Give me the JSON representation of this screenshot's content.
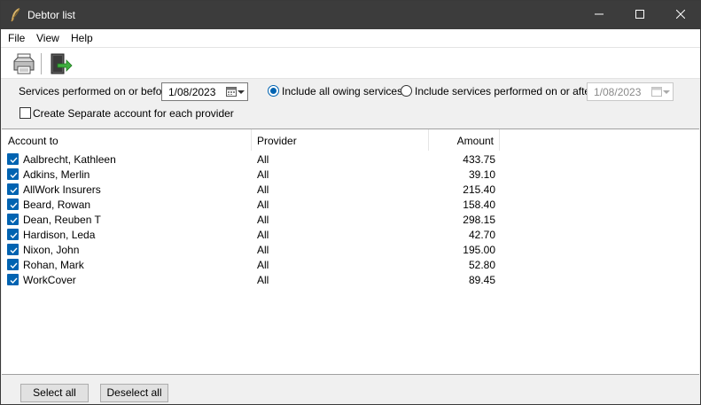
{
  "window": {
    "title": "Debtor list",
    "icons": {
      "app": "feather-quill-icon",
      "minimize": "minimize-icon",
      "maximize": "maximize-icon",
      "close": "close-icon"
    }
  },
  "menu": {
    "items": [
      {
        "label": "File"
      },
      {
        "label": "View"
      },
      {
        "label": "Help"
      }
    ]
  },
  "toolbar": {
    "print_icon": "printer-icon",
    "exit_icon": "exit-door-icon"
  },
  "options": {
    "services_before_label": "Services performed on or before:",
    "services_before_date": "1/08/2023",
    "include_all_label": "Include all owing services",
    "include_all_selected": true,
    "include_after_label": "Include services performed on or after",
    "include_after_selected": false,
    "services_after_date": "1/08/2023",
    "separate_account_label": "Create Separate account for each provider",
    "separate_account_checked": false
  },
  "list": {
    "columns": [
      "Account to",
      "Provider",
      "Amount"
    ],
    "rows": [
      {
        "account": "Aalbrecht, Kathleen",
        "provider": "All",
        "amount": "433.75",
        "checked": true
      },
      {
        "account": "Adkins, Merlin",
        "provider": "All",
        "amount": "39.10",
        "checked": true
      },
      {
        "account": "AllWork Insurers",
        "provider": "All",
        "amount": "215.40",
        "checked": true
      },
      {
        "account": "Beard, Rowan",
        "provider": "All",
        "amount": "158.40",
        "checked": true
      },
      {
        "account": "Dean, Reuben T",
        "provider": "All",
        "amount": "298.15",
        "checked": true
      },
      {
        "account": "Hardison, Leda",
        "provider": "All",
        "amount": "42.70",
        "checked": true
      },
      {
        "account": "Nixon, John",
        "provider": "All",
        "amount": "195.00",
        "checked": true
      },
      {
        "account": "Rohan, Mark",
        "provider": "All",
        "amount": "52.80",
        "checked": true
      },
      {
        "account": "WorkCover",
        "provider": "All",
        "amount": "89.45",
        "checked": true
      }
    ]
  },
  "buttons": {
    "select_all": "Select all",
    "deselect_all": "Deselect all"
  },
  "colors": {
    "accent": "#0063b1",
    "titlebar": "#3c3c3c"
  }
}
